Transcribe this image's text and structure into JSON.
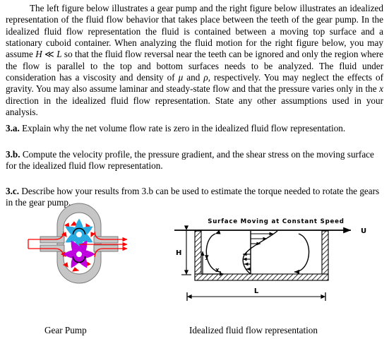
{
  "document": {
    "paragraph": {
      "p1_part1": "The left figure below illustrates a gear pump and the right figure below illustrates an idealized representation of the fluid flow behavior that takes place between the teeth of the gear pump. In the idealized fluid flow representation the fluid is contained between a moving top surface and a stationary cuboid container.  When analyzing the fluid motion for the right figure below, you may assume ",
      "sym_H": "H",
      "p1_part2": " ≪ ",
      "sym_L": "L",
      "p1_part3": " so that the fluid flow reversal near the teeth can be ignored and only the region where the flow is parallel to the top and bottom surfaces needs to be analyzed. The fluid under consideration has a viscosity and density of ",
      "sym_mu": "μ",
      "p1_part4": " and ",
      "sym_rho": "ρ",
      "p1_part5": ", respectively.  You may neglect the effects of gravity. You may also assume laminar and steady-state flow and that the pressure varies only in the ",
      "sym_x": "x",
      "p1_part6": " direction in the idealized fluid flow representation. State any other assumptions used in your analysis."
    },
    "questions": [
      {
        "label": "3.a.",
        "text": " Explain why the net volume flow rate is zero in the idealized fluid flow representation."
      },
      {
        "label": "3.b.",
        "text": " Compute the velocity profile, the pressure gradient, and the shear stress on the moving surface for the idealized fluid flow representation."
      },
      {
        "label": "3.c.",
        "text": " Describe how your results from 3.b can be used to estimate the torque needed to rotate the gears in the gear pump."
      }
    ]
  },
  "figures": {
    "gear_pump": {
      "caption": "Gear Pump",
      "colors": {
        "housing_fill": "#c6c6c6",
        "housing_stroke": "#6e6e6e",
        "gear_top": "#29abe2",
        "gear_bottom": "#bf00e0",
        "flow_arrow": "#ff0000",
        "shaft_stroke": "#000000"
      },
      "gear_top_teeth": 6,
      "gear_bottom_teeth": 6
    },
    "idealized": {
      "caption": "Idealized fluid flow representation",
      "top_label": "Surface Moving at Constant Speed",
      "speed_label": "U",
      "height_label": "H",
      "length_label": "L",
      "axis_y_label": "y",
      "axis_x_label": "x",
      "colors": {
        "line": "#000000",
        "wall_fill": "#ffffff"
      }
    }
  }
}
